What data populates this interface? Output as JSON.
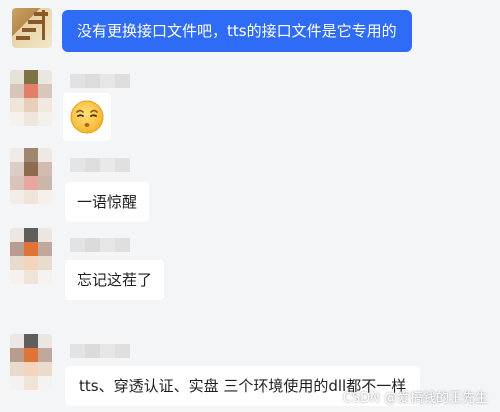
{
  "messages": [
    {
      "sender": "self",
      "text": "没有更换接口文件吧，tts的接口文件是它专用的"
    },
    {
      "sender": "other",
      "type": "emoji",
      "emoji_name": "thinking-face-emoji",
      "emoji_glyph": "😑"
    },
    {
      "sender": "other",
      "text": "一语惊醒"
    },
    {
      "sender": "other",
      "text": "忘记这茬了"
    },
    {
      "sender": "other",
      "text": "tts、穿透认证、实盘 三个环境使用的dll都不一样"
    }
  ],
  "watermark": "CSDN @爱搞钱的王先生",
  "colors": {
    "background": "#f4f5f7",
    "self_bubble": "#2f6cf6",
    "other_bubble": "#ffffff"
  }
}
